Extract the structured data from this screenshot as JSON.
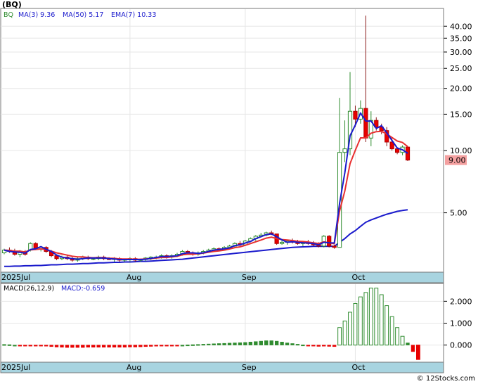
{
  "ticker": "(BQ)",
  "legend": {
    "symbol": "BQ",
    "ma3": "MA(3)  9.36",
    "ma50": "MA(50)  5.17",
    "ema7": "EMA(7)  10.33"
  },
  "macd_legend": {
    "params": "MACD(26,12,9)",
    "value": "MACD:-0.659"
  },
  "last_price_tag": "9.00",
  "watermark": "© 12Stocks.com",
  "colors": {
    "up": "#2e8b2e",
    "down": "#e80000",
    "ma3": "#1a1acc",
    "ema7": "#e83030",
    "ma50": "#1a1acc",
    "axis_band": "#a8d4e0",
    "price_tag_bg": "#f4a0a0"
  },
  "chart_data": [
    {
      "type": "candlestick",
      "title": "(BQ)",
      "ylabel": "",
      "y_scale": "log",
      "ylim": [
        2.6,
        48
      ],
      "y_ticks": [
        "5.00",
        "10.00",
        "15.00",
        "20.00",
        "25.00",
        "30.00",
        "35.00",
        "40.00"
      ],
      "y_tick_values": [
        5,
        10,
        15,
        20,
        25,
        30,
        35,
        40
      ],
      "x_tick_labels": [
        "2025Jul",
        "Aug",
        "Sep",
        "Oct"
      ],
      "x_tick_dates": [
        "2025-06-26",
        "2025-07-31",
        "2025-09-01",
        "2025-10-01"
      ],
      "dates": [
        "2025-06-26",
        "2025-06-27",
        "2025-06-30",
        "2025-07-01",
        "2025-07-02",
        "2025-07-03",
        "2025-07-07",
        "2025-07-08",
        "2025-07-09",
        "2025-07-10",
        "2025-07-11",
        "2025-07-14",
        "2025-07-15",
        "2025-07-16",
        "2025-07-17",
        "2025-07-18",
        "2025-07-21",
        "2025-07-22",
        "2025-07-23",
        "2025-07-24",
        "2025-07-25",
        "2025-07-28",
        "2025-07-29",
        "2025-07-30",
        "2025-07-31",
        "2025-08-01",
        "2025-08-04",
        "2025-08-05",
        "2025-08-06",
        "2025-08-07",
        "2025-08-08",
        "2025-08-11",
        "2025-08-12",
        "2025-08-13",
        "2025-08-14",
        "2025-08-15",
        "2025-08-18",
        "2025-08-19",
        "2025-08-20",
        "2025-08-21",
        "2025-08-22",
        "2025-08-25",
        "2025-08-26",
        "2025-08-27",
        "2025-08-28",
        "2025-08-29",
        "2025-09-02",
        "2025-09-03",
        "2025-09-04",
        "2025-09-05",
        "2025-09-08",
        "2025-09-09",
        "2025-09-10",
        "2025-09-11",
        "2025-09-12",
        "2025-09-15",
        "2025-09-16",
        "2025-09-17",
        "2025-09-18",
        "2025-09-19",
        "2025-09-22",
        "2025-09-23",
        "2025-09-24",
        "2025-09-25",
        "2025-09-26",
        "2025-09-29",
        "2025-09-30",
        "2025-10-01",
        "2025-10-02",
        "2025-10-03",
        "2025-10-06",
        "2025-10-07",
        "2025-10-08",
        "2025-10-09",
        "2025-10-10",
        "2025-10-13",
        "2025-10-14",
        "2025-10-15",
        "2025-10-16",
        "2025-10-17",
        "2025-10-20",
        "2025-10-21"
      ],
      "ohlc": [
        [
          3.2,
          3.35,
          3.15,
          3.3
        ],
        [
          3.3,
          3.4,
          3.2,
          3.25
        ],
        [
          3.25,
          3.35,
          3.1,
          3.15
        ],
        [
          3.15,
          3.3,
          3.05,
          3.25
        ],
        [
          3.25,
          3.3,
          3.1,
          3.15
        ],
        [
          3.3,
          3.6,
          3.25,
          3.55
        ],
        [
          3.55,
          3.6,
          3.3,
          3.35
        ],
        [
          3.35,
          3.45,
          3.25,
          3.4
        ],
        [
          3.4,
          3.45,
          3.2,
          3.25
        ],
        [
          3.25,
          3.3,
          3.05,
          3.1
        ],
        [
          3.1,
          3.15,
          2.95,
          3.0
        ],
        [
          3.0,
          3.1,
          2.95,
          3.05
        ],
        [
          3.05,
          3.1,
          2.95,
          3.0
        ],
        [
          3.0,
          3.05,
          2.9,
          2.95
        ],
        [
          2.95,
          3.05,
          2.9,
          3.0
        ],
        [
          3.0,
          3.1,
          2.95,
          3.05
        ],
        [
          3.05,
          3.1,
          2.95,
          3.0
        ],
        [
          3.0,
          3.05,
          2.95,
          3.0
        ],
        [
          3.0,
          3.1,
          2.95,
          3.05
        ],
        [
          3.05,
          3.1,
          2.95,
          3.0
        ],
        [
          3.0,
          3.05,
          2.95,
          2.97
        ],
        [
          2.97,
          3.05,
          2.9,
          3.0
        ],
        [
          3.0,
          3.05,
          2.9,
          2.95
        ],
        [
          2.95,
          3.0,
          2.9,
          2.97
        ],
        [
          2.97,
          3.05,
          2.9,
          3.0
        ],
        [
          3.0,
          3.05,
          2.9,
          2.95
        ],
        [
          2.95,
          3.0,
          2.9,
          2.97
        ],
        [
          2.97,
          3.05,
          2.92,
          3.02
        ],
        [
          3.02,
          3.08,
          2.95,
          3.05
        ],
        [
          3.05,
          3.1,
          2.98,
          3.05
        ],
        [
          3.05,
          3.15,
          3.0,
          3.1
        ],
        [
          3.1,
          3.15,
          3.0,
          3.05
        ],
        [
          3.05,
          3.15,
          3.0,
          3.1
        ],
        [
          3.1,
          3.2,
          3.05,
          3.15
        ],
        [
          3.15,
          3.3,
          3.1,
          3.25
        ],
        [
          3.25,
          3.3,
          3.15,
          3.2
        ],
        [
          3.2,
          3.25,
          3.1,
          3.15
        ],
        [
          3.15,
          3.25,
          3.1,
          3.2
        ],
        [
          3.2,
          3.3,
          3.15,
          3.25
        ],
        [
          3.25,
          3.35,
          3.2,
          3.3
        ],
        [
          3.3,
          3.4,
          3.25,
          3.35
        ],
        [
          3.35,
          3.4,
          3.25,
          3.3
        ],
        [
          3.3,
          3.45,
          3.28,
          3.4
        ],
        [
          3.4,
          3.5,
          3.35,
          3.45
        ],
        [
          3.45,
          3.6,
          3.4,
          3.55
        ],
        [
          3.55,
          3.65,
          3.45,
          3.5
        ],
        [
          3.5,
          3.7,
          3.45,
          3.65
        ],
        [
          3.65,
          3.8,
          3.6,
          3.75
        ],
        [
          3.75,
          3.9,
          3.65,
          3.85
        ],
        [
          3.85,
          4.0,
          3.8,
          3.9
        ],
        [
          3.9,
          4.05,
          3.85,
          4.0
        ],
        [
          4.0,
          4.1,
          3.9,
          3.95
        ],
        [
          3.95,
          3.95,
          3.5,
          3.55
        ],
        [
          3.55,
          3.7,
          3.5,
          3.6
        ],
        [
          3.6,
          3.7,
          3.5,
          3.65
        ],
        [
          3.65,
          3.75,
          3.55,
          3.6
        ],
        [
          3.6,
          3.7,
          3.5,
          3.55
        ],
        [
          3.55,
          3.65,
          3.45,
          3.6
        ],
        [
          3.6,
          3.7,
          3.5,
          3.55
        ],
        [
          3.55,
          3.65,
          3.45,
          3.5
        ],
        [
          3.5,
          3.6,
          3.4,
          3.45
        ],
        [
          3.45,
          3.9,
          3.4,
          3.85
        ],
        [
          3.85,
          3.9,
          3.4,
          3.45
        ],
        [
          3.45,
          3.5,
          3.35,
          3.4
        ],
        [
          3.4,
          18.0,
          3.4,
          9.8
        ],
        [
          9.8,
          14.0,
          8.8,
          10.2
        ],
        [
          10.2,
          24.0,
          9.5,
          15.5
        ],
        [
          15.5,
          16.5,
          13.0,
          14.2
        ],
        [
          14.2,
          17.5,
          13.5,
          16.0
        ],
        [
          16.0,
          45.0,
          11.0,
          11.5
        ],
        [
          11.5,
          15.5,
          10.5,
          14.0
        ],
        [
          14.0,
          14.5,
          12.5,
          13.0
        ],
        [
          13.0,
          13.5,
          12.0,
          12.5
        ],
        [
          12.5,
          13.0,
          10.5,
          11.0
        ],
        [
          11.0,
          11.5,
          10.0,
          10.2
        ],
        [
          10.2,
          10.3,
          9.6,
          9.8
        ],
        [
          9.8,
          10.6,
          9.5,
          10.4
        ],
        [
          10.4,
          10.5,
          8.9,
          9.0
        ]
      ],
      "ma3": [
        3.3,
        3.25,
        3.23,
        3.22,
        3.19,
        3.32,
        3.35,
        3.43,
        3.33,
        3.25,
        3.12,
        3.05,
        3.02,
        3.0,
        2.98,
        3.0,
        3.02,
        3.02,
        3.02,
        3.02,
        3.0,
        2.99,
        2.97,
        2.97,
        2.97,
        2.97,
        2.97,
        2.98,
        3.01,
        3.04,
        3.07,
        3.07,
        3.08,
        3.1,
        3.17,
        3.2,
        3.2,
        3.18,
        3.2,
        3.25,
        3.3,
        3.32,
        3.35,
        3.38,
        3.47,
        3.5,
        3.57,
        3.63,
        3.75,
        3.83,
        3.92,
        3.95,
        3.83,
        3.7,
        3.6,
        3.62,
        3.6,
        3.58,
        3.57,
        3.55,
        3.5,
        3.6,
        3.58,
        3.57,
        5.56,
        7.8,
        11.8,
        13.3,
        15.2,
        13.9,
        13.9,
        12.8,
        13.2,
        12.2,
        11.2,
        10.3,
        10.1,
        9.7
      ],
      "ema7": [
        3.3,
        3.29,
        3.26,
        3.26,
        3.23,
        3.31,
        3.32,
        3.34,
        3.32,
        3.26,
        3.2,
        3.16,
        3.12,
        3.08,
        3.06,
        3.06,
        3.04,
        3.03,
        3.04,
        3.03,
        3.01,
        3.01,
        2.99,
        2.99,
        2.99,
        2.98,
        2.98,
        2.99,
        3.0,
        3.02,
        3.04,
        3.04,
        3.06,
        3.08,
        3.13,
        3.15,
        3.15,
        3.17,
        3.19,
        3.22,
        3.25,
        3.27,
        3.3,
        3.34,
        3.39,
        3.42,
        3.48,
        3.55,
        3.62,
        3.69,
        3.77,
        3.81,
        3.75,
        3.71,
        3.69,
        3.67,
        3.64,
        3.63,
        3.61,
        3.58,
        3.55,
        3.62,
        3.58,
        3.54,
        5.1,
        6.37,
        8.65,
        10.04,
        11.53,
        11.52,
        12.14,
        12.35,
        12.39,
        12.04,
        11.58,
        11.13,
        10.95,
        10.46
      ],
      "ma50": [
        2.75,
        2.75,
        2.76,
        2.76,
        2.77,
        2.77,
        2.78,
        2.78,
        2.79,
        2.8,
        2.8,
        2.81,
        2.82,
        2.82,
        2.83,
        2.84,
        2.84,
        2.85,
        2.86,
        2.86,
        2.87,
        2.88,
        2.88,
        2.89,
        2.89,
        2.9,
        2.91,
        2.91,
        2.92,
        2.93,
        2.94,
        2.95,
        2.96,
        2.97,
        2.98,
        3.0,
        3.02,
        3.04,
        3.06,
        3.08,
        3.1,
        3.12,
        3.14,
        3.16,
        3.18,
        3.2,
        3.22,
        3.24,
        3.26,
        3.28,
        3.3,
        3.32,
        3.34,
        3.36,
        3.38,
        3.4,
        3.41,
        3.42,
        3.43,
        3.44,
        3.44,
        3.44,
        3.44,
        3.44,
        3.6,
        3.75,
        3.95,
        4.1,
        4.3,
        4.5,
        4.62,
        4.72,
        4.82,
        4.92,
        5.0,
        5.08,
        5.13,
        5.17
      ],
      "last_price": 9.0
    },
    {
      "type": "bar",
      "title": "MACD(26,12,9)",
      "ylim": [
        -0.75,
        2.75
      ],
      "y_ticks": [
        "0.000",
        "1.000",
        "2.000"
      ],
      "y_tick_values": [
        0,
        1,
        2
      ],
      "x_tick_labels": [
        "2025Jul",
        "Aug",
        "Sep",
        "Oct"
      ],
      "values": [
        0.03,
        0.02,
        0.0,
        -0.02,
        -0.03,
        -0.02,
        -0.03,
        -0.04,
        -0.05,
        -0.07,
        -0.09,
        -0.1,
        -0.11,
        -0.11,
        -0.11,
        -0.11,
        -0.1,
        -0.1,
        -0.1,
        -0.1,
        -0.1,
        -0.1,
        -0.1,
        -0.1,
        -0.09,
        -0.09,
        -0.08,
        -0.07,
        -0.06,
        -0.05,
        -0.04,
        -0.03,
        -0.02,
        -0.01,
        0.0,
        0.01,
        0.02,
        0.03,
        0.04,
        0.05,
        0.06,
        0.07,
        0.08,
        0.09,
        0.1,
        0.11,
        0.12,
        0.14,
        0.16,
        0.18,
        0.2,
        0.2,
        0.18,
        0.14,
        0.1,
        0.07,
        0.04,
        0.01,
        -0.02,
        -0.04,
        -0.06,
        -0.05,
        -0.06,
        -0.07,
        0.8,
        1.1,
        1.5,
        1.9,
        2.2,
        2.4,
        2.6,
        2.6,
        2.3,
        1.8,
        1.3,
        0.8,
        0.4,
        0.1,
        -0.3,
        -0.659
      ]
    }
  ]
}
